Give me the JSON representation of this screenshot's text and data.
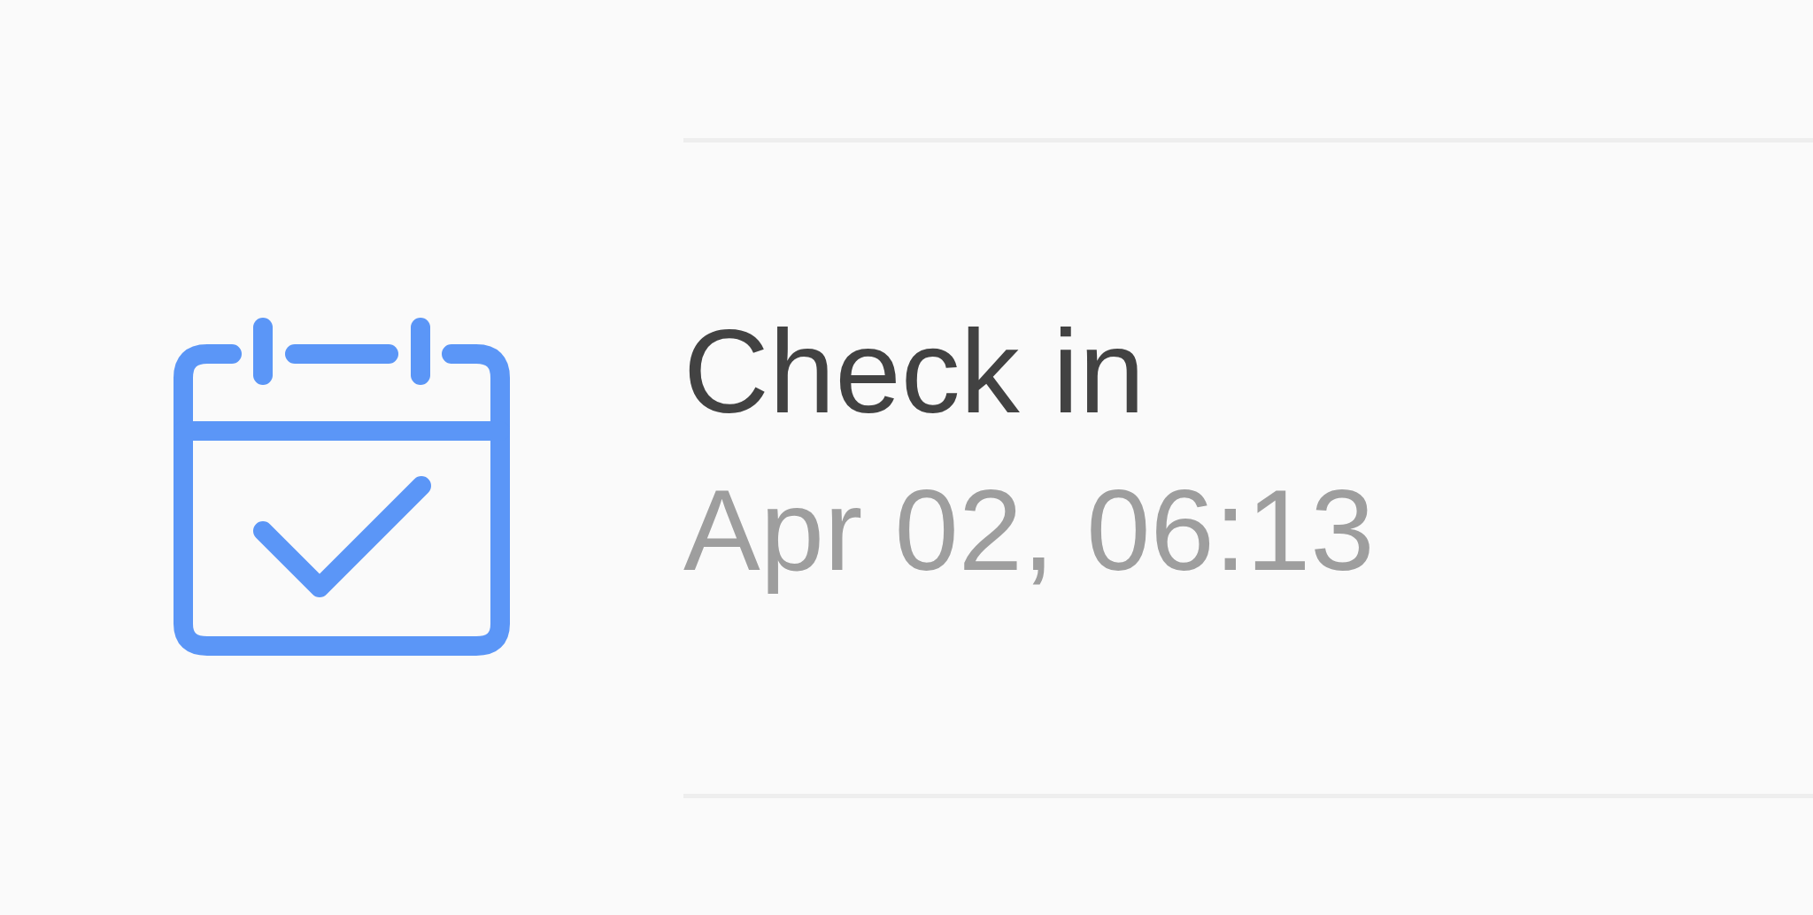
{
  "entry": {
    "title": "Check in",
    "time": "Apr 02, 06:13"
  }
}
